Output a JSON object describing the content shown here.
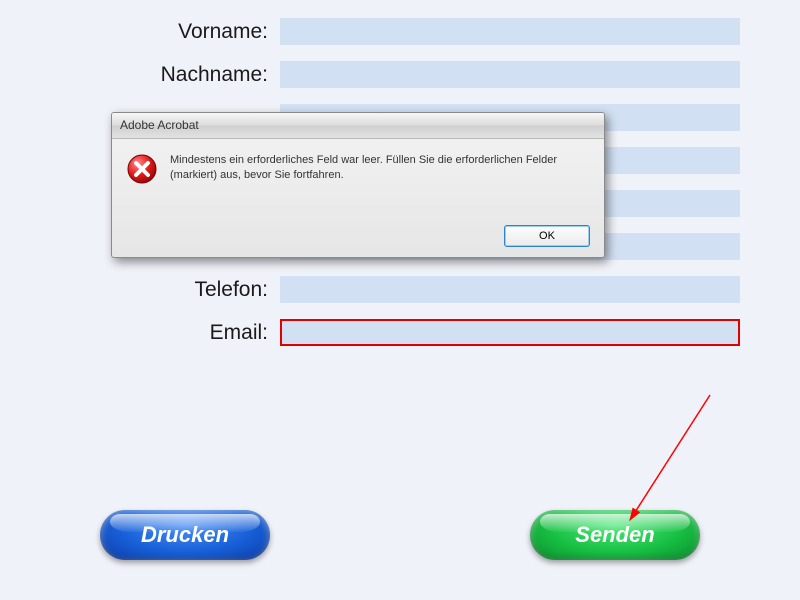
{
  "form": {
    "rows": [
      {
        "label": "Vorname:",
        "value": ""
      },
      {
        "label": "Nachname:",
        "value": ""
      },
      {
        "label": "",
        "value": ""
      },
      {
        "label": "",
        "value": ""
      },
      {
        "label": "",
        "value": ""
      },
      {
        "label": "",
        "value": ""
      },
      {
        "label": "Telefon:",
        "value": ""
      },
      {
        "label": "Email:",
        "value": "",
        "required": true
      }
    ]
  },
  "buttons": {
    "print": "Drucken",
    "send": "Senden"
  },
  "dialog": {
    "title": "Adobe Acrobat",
    "message": "Mindestens ein erforderliches Feld war leer. Füllen Sie die erforderlichen Felder (markiert) aus, bevor Sie fortfahren.",
    "ok": "OK"
  }
}
